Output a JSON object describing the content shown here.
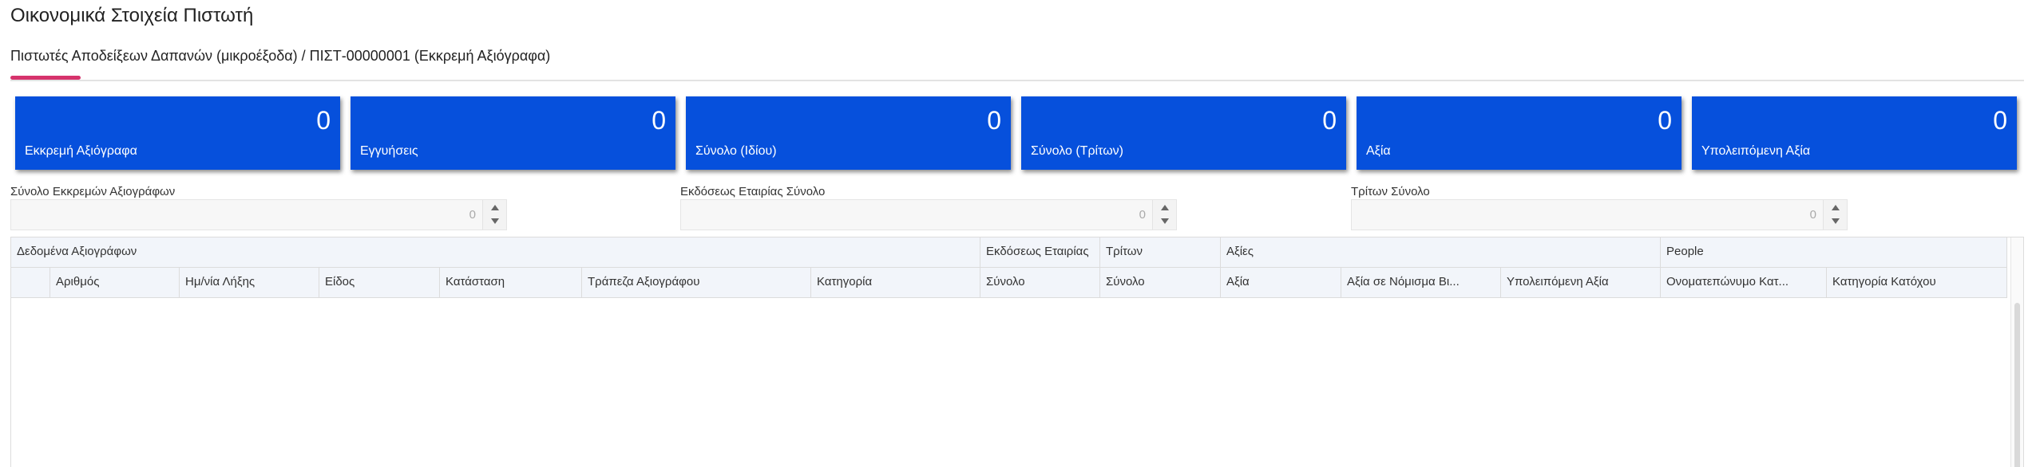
{
  "page_title": "Οικονομικά Στοιχεία Πιστωτή",
  "tab": {
    "label": "Πιστωτές Αποδείξεων Δαπανών (μικροέξοδα) / ΠΙΣΤ-00000001 (Εκκρεμή Αξιόγραφα)"
  },
  "colors": {
    "kpi_tile": "#0650dc",
    "tab_accent": "#d6336c"
  },
  "kpis": [
    {
      "value": "0",
      "label": "Εκκρεμή Αξιόγραφα"
    },
    {
      "value": "0",
      "label": "Εγγυήσεις"
    },
    {
      "value": "0",
      "label": "Σύνολο (Ιδίου)"
    },
    {
      "value": "0",
      "label": "Σύνολο (Τρίτων)"
    },
    {
      "value": "0",
      "label": "Αξία"
    },
    {
      "value": "0",
      "label": "Υπολειπόμενη Αξία"
    }
  ],
  "fields": [
    {
      "label": "Σύνολο Εκκρεμών Αξιογράφων",
      "value": "0"
    },
    {
      "label": "Εκδόσεως Εταιρίας Σύνολο",
      "value": "0"
    },
    {
      "label": "Τρίτων Σύνολο",
      "value": "0"
    }
  ],
  "grid": {
    "groups": [
      "Δεδομένα Αξιογράφων",
      "Εκδόσεως Εταιρίας",
      "Τρίτων",
      "Αξίες",
      "People"
    ],
    "columns": [
      "",
      "Αριθμός",
      "Ημ/νία Λήξης",
      "Είδος",
      "Κατάσταση",
      "Τράπεζα Αξιογράφου",
      "Κατηγορία",
      "Σύνολο",
      "Σύνολο",
      "Αξία",
      "Αξία σε Νόμισμα Βι...",
      "Υπολειπόμενη Αξία",
      "Ονοματεπώνυμο Κατ...",
      "Κατηγορία Κατόχου"
    ],
    "rows": []
  }
}
